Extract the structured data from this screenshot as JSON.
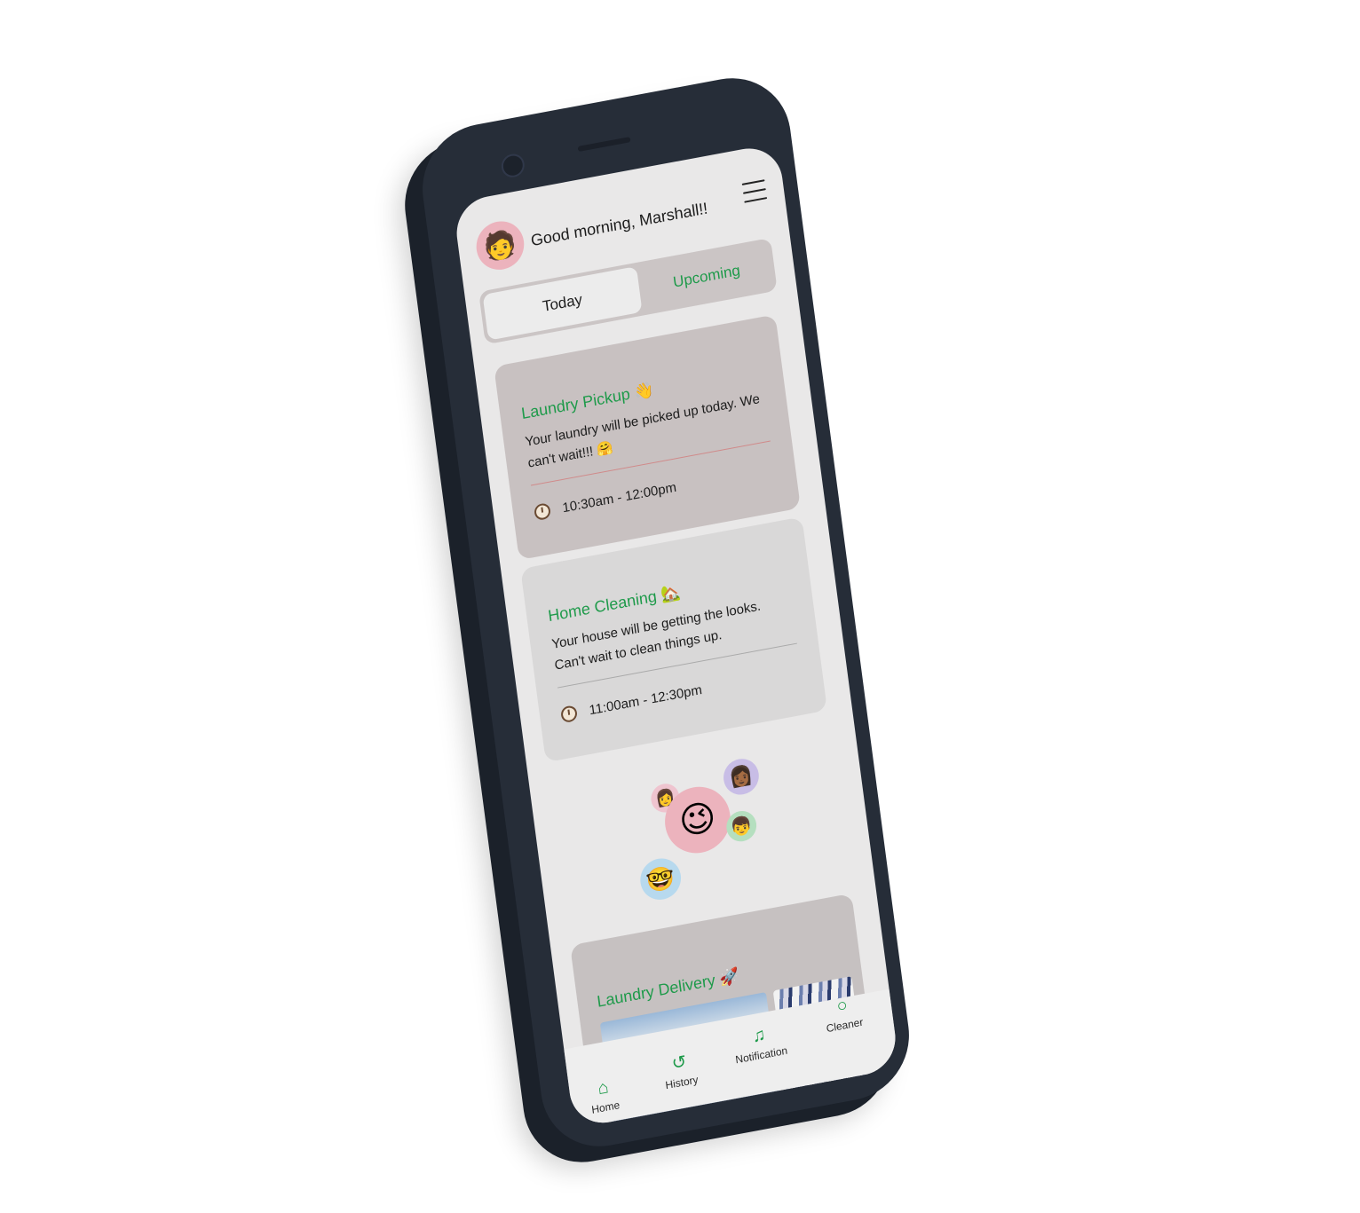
{
  "header": {
    "greeting": "Good morning, Marshall!!",
    "avatar_icon": "memoji-avatar",
    "menu_icon": "hamburger-menu-icon"
  },
  "tabs": {
    "today": "Today",
    "upcoming": "Upcoming",
    "active": "Today"
  },
  "cards": [
    {
      "title": "Laundry Pickup 👋",
      "description": "Your laundry will be picked up today. We can't wait!!! 🤗",
      "time": "10:30am - 12:00pm"
    },
    {
      "title": "Home Cleaning 🏡",
      "description": "Your house will be getting the looks. Can't wait to clean things up.",
      "time": "11:00am - 12:30pm"
    }
  ],
  "delivery": {
    "title": "Laundry Delivery 🚀"
  },
  "nav": {
    "home": "Home",
    "history": "History",
    "notification": "Notification",
    "cleaner": "Cleaner"
  },
  "colors": {
    "accent_green": "#1e9a4a",
    "phone_body": "#262d38",
    "avatar_pink": "#ecb3bd"
  }
}
